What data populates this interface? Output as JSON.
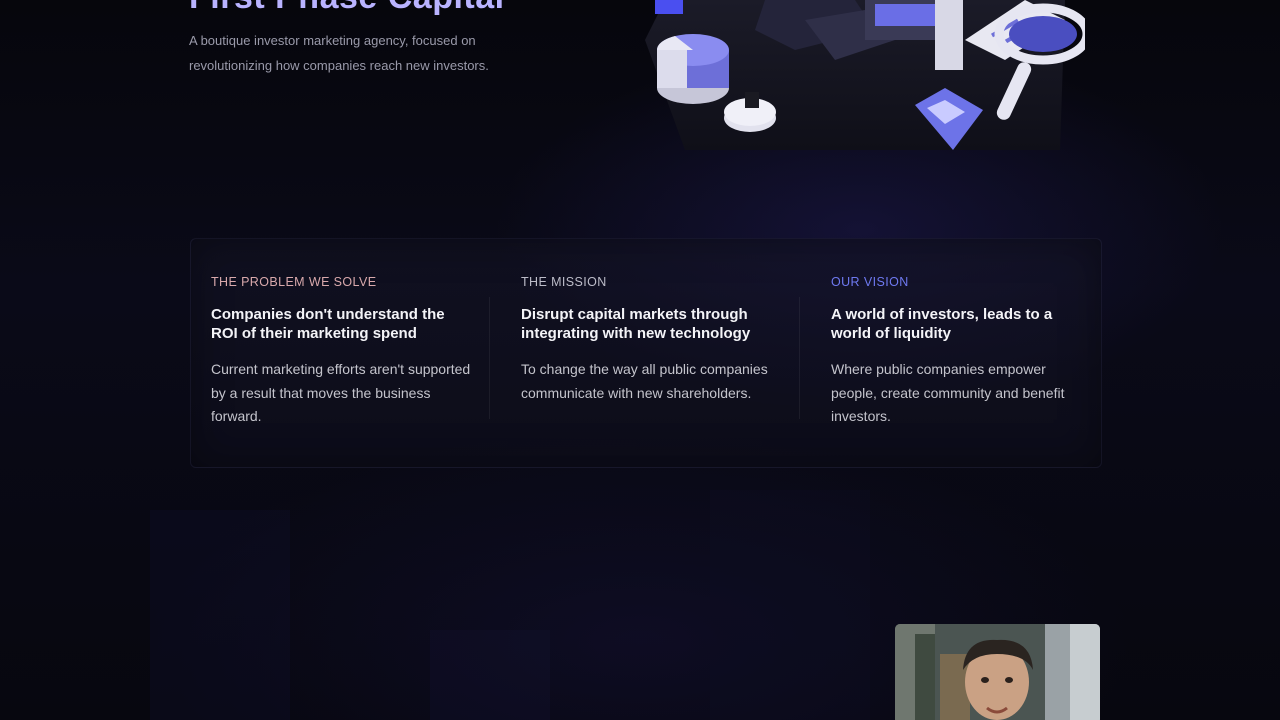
{
  "hero": {
    "title": "First Phase Capital",
    "description": "A boutique investor marketing agency, focused on revolutionizing how companies reach new investors."
  },
  "colors": {
    "accent_title": "#b9b3ff",
    "eyebrow_problem": "#d9a9ac",
    "eyebrow_mission": "#bcbcc8",
    "eyebrow_vision": "#6e79f0"
  },
  "features": [
    {
      "eyebrow": "THE PROBLEM WE SOLVE",
      "heading": "Companies don't understand the ROI of their marketing spend",
      "body": "Current marketing efforts aren't supported by a result that moves the business forward."
    },
    {
      "eyebrow": "THE MISSION",
      "heading": "Disrupt capital markets through integrating with new technology",
      "body": "To change the way all public companies communicate with new shareholders."
    },
    {
      "eyebrow": "OUR VISION",
      "heading": "A world of investors, leads to a world of liquidity",
      "body": "Where public companies empower people, create community and benefit investors."
    }
  ],
  "icons": {
    "hero_illustration": "isometric-office-illustration",
    "team_photo": "person-photo"
  }
}
